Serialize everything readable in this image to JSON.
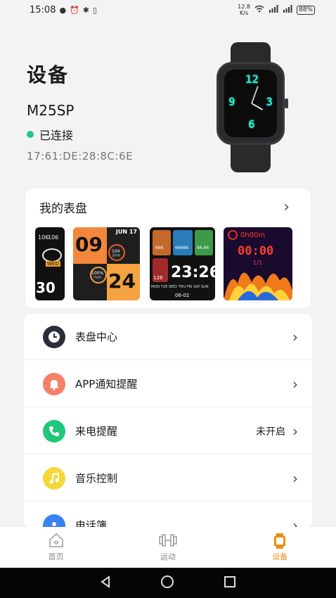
{
  "status_bar": {
    "time": "15:08",
    "net_speed_value": "12.8",
    "net_speed_unit": "K/s",
    "battery": "88%"
  },
  "header": {
    "title": "设备",
    "device_name": "M25SP",
    "status": "已连接",
    "mac_address": "17:61:DE:28:8C:6E"
  },
  "watch_faces": {
    "section_title": "我的表盘",
    "face1": {
      "num1": "106",
      "num2": "106",
      "badge": "WED",
      "big": "30"
    },
    "face2": {
      "date": "JUN 17",
      "hour": "09",
      "min": "24",
      "stat1": "104",
      "stat1_unit": "BPM",
      "stat2": "100%",
      "stat2_unit": "PWR"
    },
    "face3": {
      "v1": "666",
      "v2": "66666",
      "v3": "66.66",
      "hr": "128",
      "time": "23:26",
      "days": "MON TUE WED THU FRI SAT SUN",
      "date": "06-02"
    },
    "face4": {
      "timer_top": "0h00m",
      "timer": "00:00",
      "sub": "1/1"
    }
  },
  "menu": {
    "items": [
      {
        "label": "表盘中心",
        "value": "",
        "icon": "clock-icon",
        "color": "#2b2e3a"
      },
      {
        "label": "APP通知提醒",
        "value": "",
        "icon": "bell-icon",
        "color": "#f47f6b"
      },
      {
        "label": "来电提醒",
        "value": "未开启",
        "icon": "phone-icon",
        "color": "#1ec87a"
      },
      {
        "label": "音乐控制",
        "value": "",
        "icon": "music-note-icon",
        "color": "#f3d83a"
      },
      {
        "label": "电话簿",
        "value": "",
        "icon": "contacts-icon",
        "color": "#3a82f2"
      }
    ]
  },
  "bottom_nav": {
    "tabs": [
      {
        "label": "首页",
        "active": false
      },
      {
        "label": "运动",
        "active": false
      },
      {
        "label": "设备",
        "active": true
      }
    ]
  },
  "colors": {
    "accent": "#e88f18",
    "connected": "#23c489",
    "watch_digits": "#2ee6c6"
  }
}
